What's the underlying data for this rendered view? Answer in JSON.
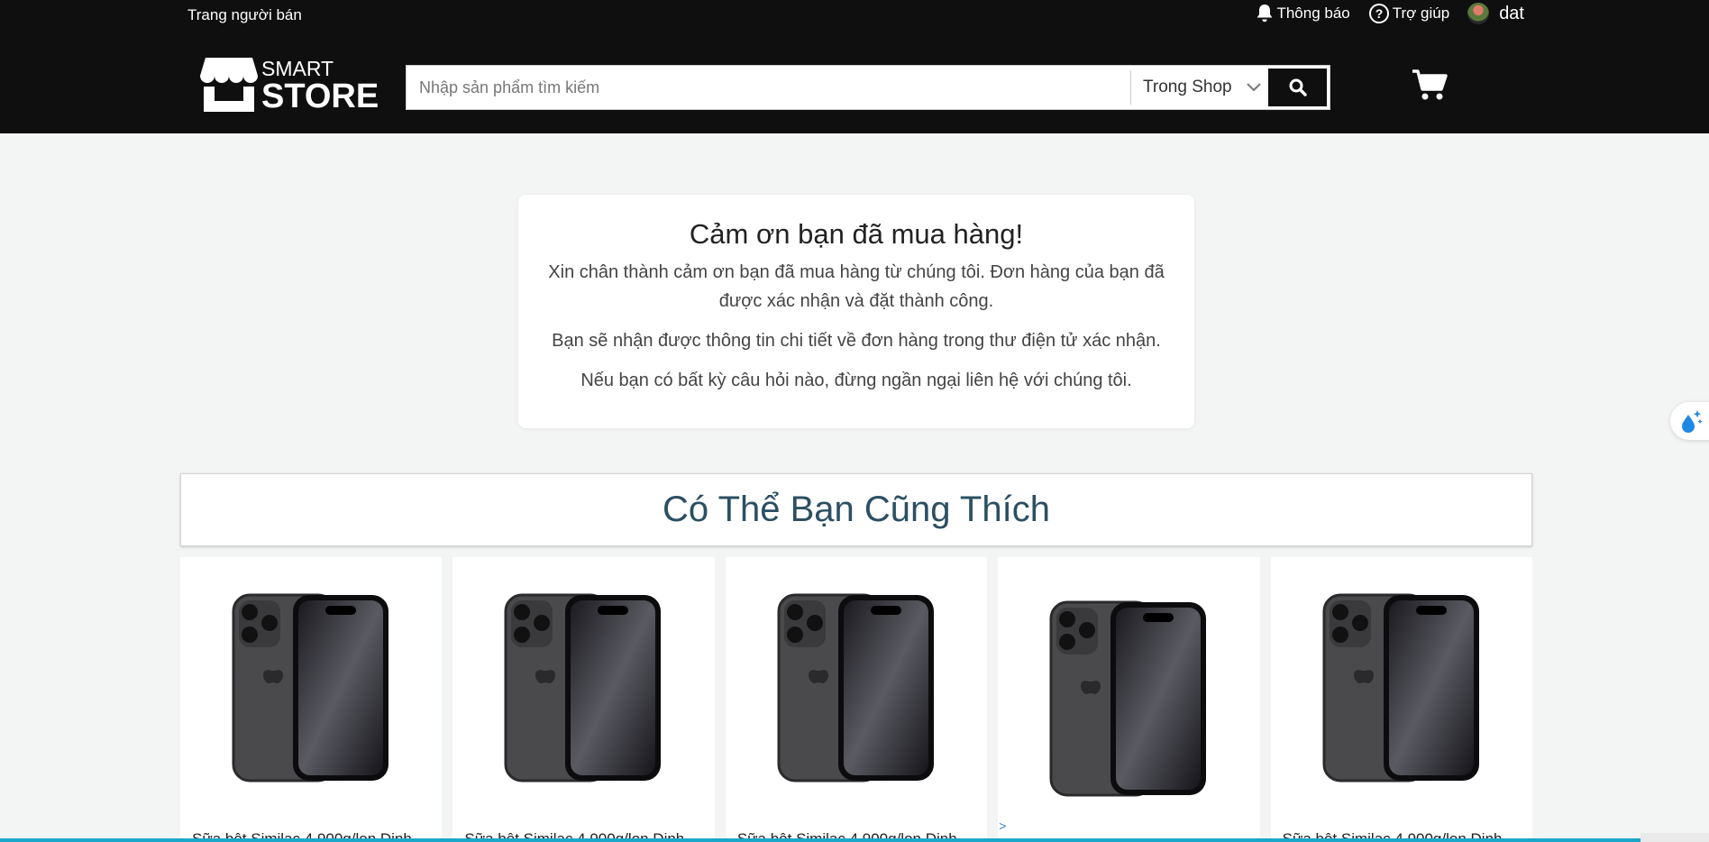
{
  "topbar": {
    "seller_link": "Trang người bán",
    "notifications": "Thông báo",
    "help": "Trợ giúp",
    "user": "dat"
  },
  "logo": {
    "line1": "SMART",
    "line2": "STORE"
  },
  "search": {
    "placeholder": "Nhập sản phẩm tìm kiếm",
    "value": "",
    "scope": "Trong Shop"
  },
  "thanks": {
    "title": "Cảm ơn bạn đã mua hàng!",
    "p1": "Xin chân thành cảm ơn bạn đã mua hàng từ chúng tôi. Đơn hàng của bạn đã được xác nhận và đặt thành công.",
    "p2": "Bạn sẽ nhận được thông tin chi tiết về đơn hàng trong thư điện tử xác nhận.",
    "p3": "Nếu bạn có bất kỳ câu hỏi nào, đừng ngần ngại liên hệ với chúng tôi."
  },
  "suggestions": {
    "title": "Có Thể Bạn Cũng Thích",
    "products": [
      {
        "name": "Sữa bột Similac 4,900g/lon Dinh"
      },
      {
        "name": "Sữa bột Similac 4,900g/lon Dinh"
      },
      {
        "name": "Sữa bột Similac 4,900g/lon Dinh"
      },
      {
        "name": "",
        "link": ">"
      },
      {
        "name": "Sữa bột Similac 4,900g/lon Dinh"
      }
    ]
  },
  "icons": {
    "notifications": "bell-icon",
    "help": "question-circle-icon",
    "search": "search-icon",
    "scope": "chevron-down-icon",
    "cart": "cart-icon",
    "side_widget": "water-drop-sparkle-icon"
  }
}
